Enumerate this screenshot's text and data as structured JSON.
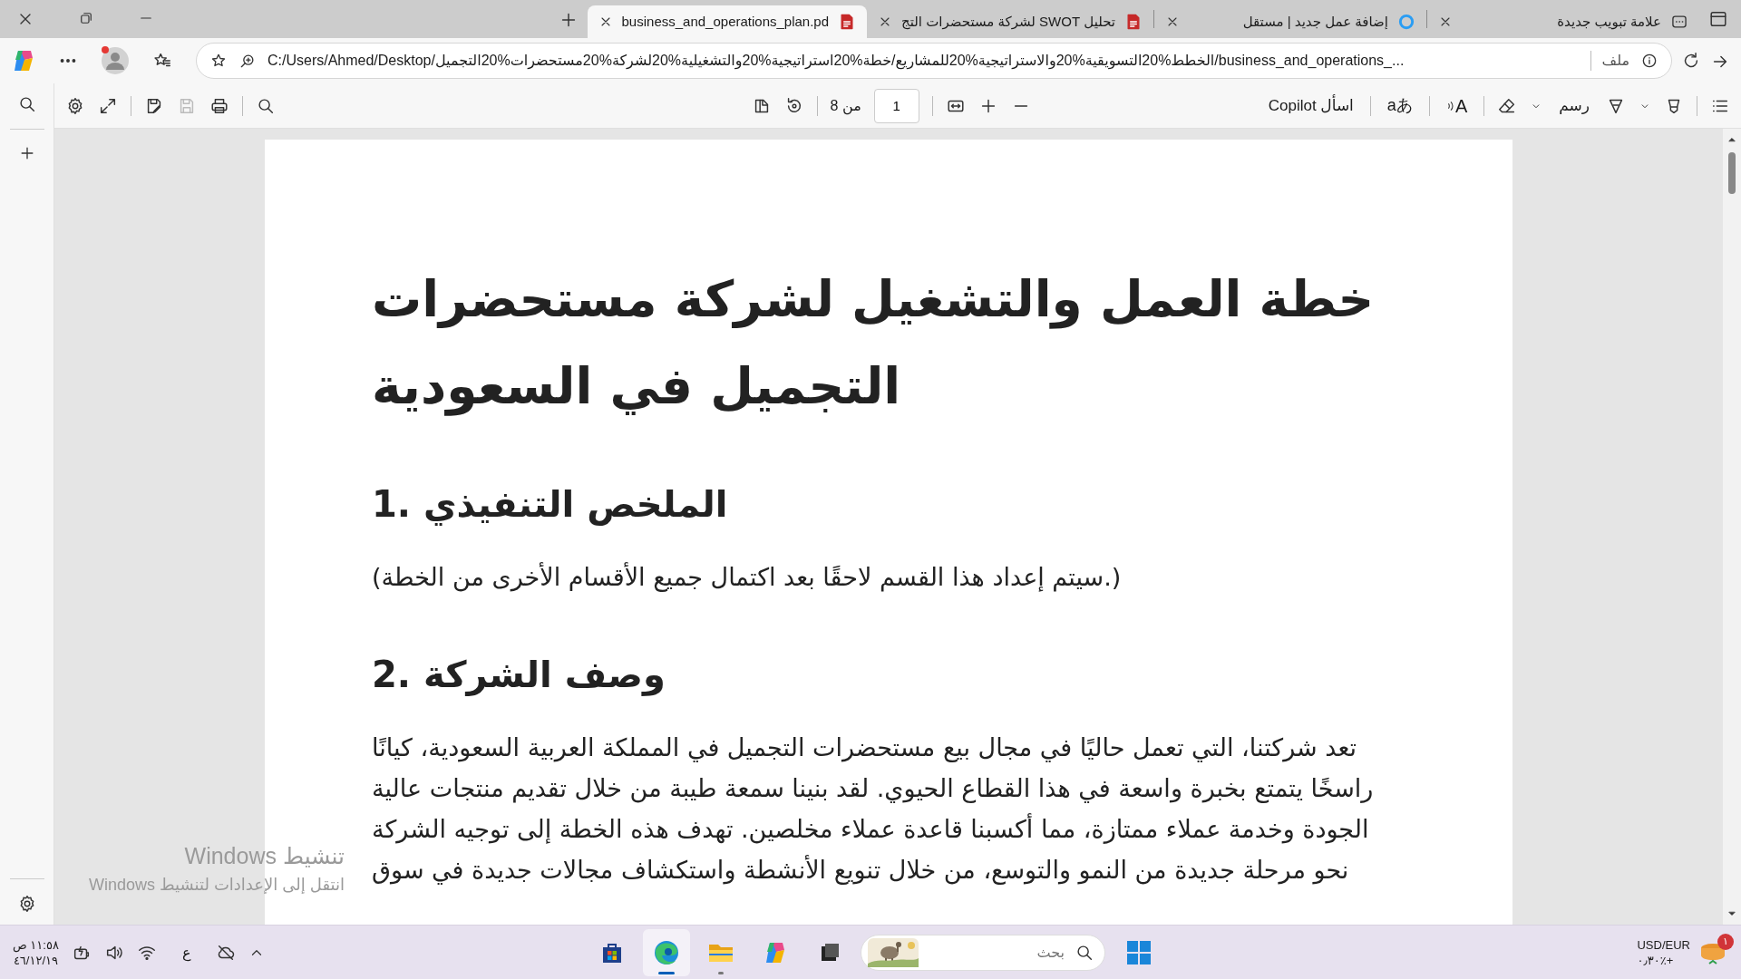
{
  "tabs": [
    {
      "kind": "newtab",
      "title": "علامة تبويب جديدة",
      "selected": false
    },
    {
      "kind": "web",
      "title": "إضافة عمل جديد | مستقل",
      "selected": false
    },
    {
      "kind": "pdf",
      "title": "تحليل SWOT لشركة مستحضرات التج",
      "selected": false
    },
    {
      "kind": "pdf",
      "title": "business_and_operations_plan.pd",
      "selected": true
    }
  ],
  "address": {
    "file_label": "ملف",
    "url": "C:/Users/Ahmed/Desktop/الخطط%20التسويقية%20والاستراتيجية%20للمشاريع/خطة%20استراتيجية%20والتشغيلية%20لشركة%20مستحضرات%20التجميل/business_and_operations_..."
  },
  "pdf_toolbar": {
    "draw": "رسم",
    "read_aloud": "A",
    "translate": "aあ",
    "ask_copilot": "اسأل Copilot",
    "page": "1",
    "page_total": "من 8"
  },
  "document": {
    "title": "خطة العمل والتشغيل لشركة مستحضرات التجميل في السعودية",
    "sections": [
      {
        "heading": "1. الملخص التنفيذي",
        "paragraph": "(سيتم إعداد هذا القسم لاحقًا بعد اكتمال جميع الأقسام الأخرى من الخطة.)"
      },
      {
        "heading": "2. وصف الشركة",
        "paragraph": "تعد شركتنا، التي تعمل حاليًا في مجال بيع مستحضرات التجميل في المملكة العربية السعودية، كيانًا راسخًا يتمتع بخبرة واسعة في هذا القطاع الحيوي. لقد بنينا سمعة طيبة من خلال تقديم منتجات عالية الجودة وخدمة عملاء ممتازة، مما أكسبنا قاعدة عملاء مخلصين. تهدف هذه الخطة إلى توجيه الشركة نحو مرحلة جديدة من النمو والتوسع، من خلال تنويع الأنشطة واستكشاف مجالات جديدة في سوق"
      }
    ]
  },
  "activation": {
    "title": "تنشيط Windows",
    "subtitle": "انتقل إلى الإعدادات لتنشيط Windows"
  },
  "taskbar": {
    "widget": {
      "title": "USD/EUR",
      "change": "٠٫٣٠٪+",
      "badge": "١"
    },
    "search": {
      "placeholder": "بحث"
    },
    "apps": [
      {
        "kind": "taskview",
        "running": false,
        "selected": false
      },
      {
        "kind": "copilot",
        "running": false,
        "selected": false
      },
      {
        "kind": "explorer",
        "running": true,
        "selected": false
      },
      {
        "kind": "edge",
        "running": true,
        "selected": true
      },
      {
        "kind": "store",
        "running": false,
        "selected": false
      }
    ],
    "language": "ع",
    "time": "١١:٥٨ ص",
    "date": "٤٦/١٢/١٩"
  }
}
